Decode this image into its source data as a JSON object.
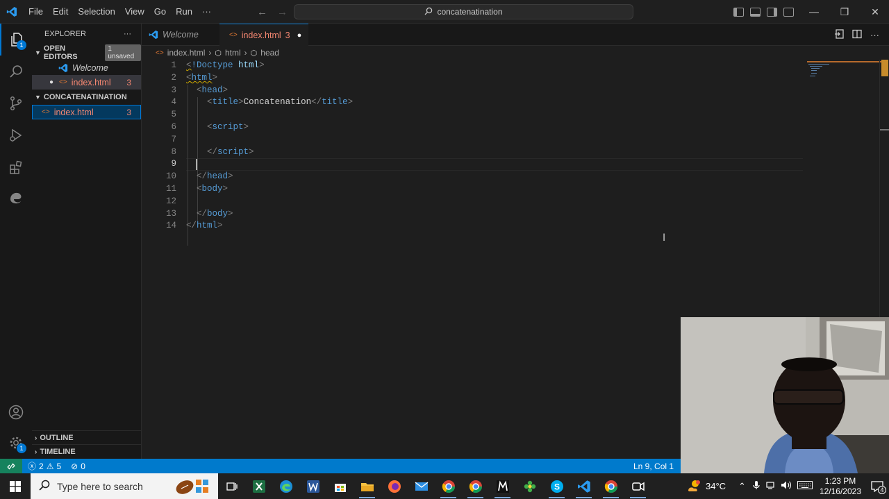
{
  "titlebar": {
    "menu": [
      "File",
      "Edit",
      "Selection",
      "View",
      "Go",
      "Run",
      "···"
    ],
    "search_text": "concatenatination"
  },
  "activity": {
    "explorer_badge": "1",
    "settings_badge": "1"
  },
  "sidebar": {
    "title": "EXPLORER",
    "more": "···",
    "open_editors_label": "OPEN EDITORS",
    "unsaved_badge": "1 unsaved",
    "open_editors": [
      {
        "label": "Welcome",
        "count": ""
      },
      {
        "label": "index.html",
        "count": "3"
      }
    ],
    "folder_label": "CONCATENATINATION",
    "files": [
      {
        "label": "index.html",
        "count": "3"
      }
    ],
    "outline_label": "OUTLINE",
    "timeline_label": "TIMELINE"
  },
  "tabs": [
    {
      "label": "Welcome"
    },
    {
      "label": "index.html",
      "problems": "3"
    }
  ],
  "breadcrumb": [
    "index.html",
    "html",
    "head"
  ],
  "editor": {
    "line_numbers": [
      "1",
      "2",
      "3",
      "4",
      "5",
      "6",
      "7",
      "8",
      "9",
      "10",
      "11",
      "12",
      "13",
      "14"
    ],
    "current_line": "9",
    "lines": {
      "l1": {
        "lt": "<",
        "bang": "!Doctype",
        "html_kw": "html",
        "gt": ">"
      },
      "l2": {
        "open": "<",
        "tag": "html",
        "close": ">"
      },
      "l3": {
        "open": "<",
        "tag": "head",
        "close": ">"
      },
      "l4": {
        "open": "<",
        "tag": "title",
        "close": ">",
        "text": "Concatenation",
        "open2": "</",
        "tag2": "title",
        "close2": ">"
      },
      "l6": {
        "open": "<",
        "tag": "script",
        "close": ">"
      },
      "l8": {
        "open": "</",
        "tag": "script",
        "close": ">"
      },
      "l10": {
        "open": "</",
        "tag": "head",
        "close": ">"
      },
      "l11": {
        "open": "<",
        "tag": "body",
        "close": ">"
      },
      "l13": {
        "open": "</",
        "tag": "body",
        "close": ">"
      },
      "l14": {
        "open": "</",
        "tag": "html",
        "close": ">"
      }
    }
  },
  "statusbar": {
    "errors": "2",
    "warnings": "5",
    "ports": "0",
    "position": "Ln 9, Col 1"
  },
  "taskbar": {
    "search_placeholder": "Type here to search",
    "weather": "34°C",
    "time": "1:23 PM",
    "date": "12/16/2023",
    "notification_count": "4"
  },
  "colors": {
    "accent": "#0078d4",
    "statusbar": "#007acc",
    "modified_file": "#f48771"
  }
}
